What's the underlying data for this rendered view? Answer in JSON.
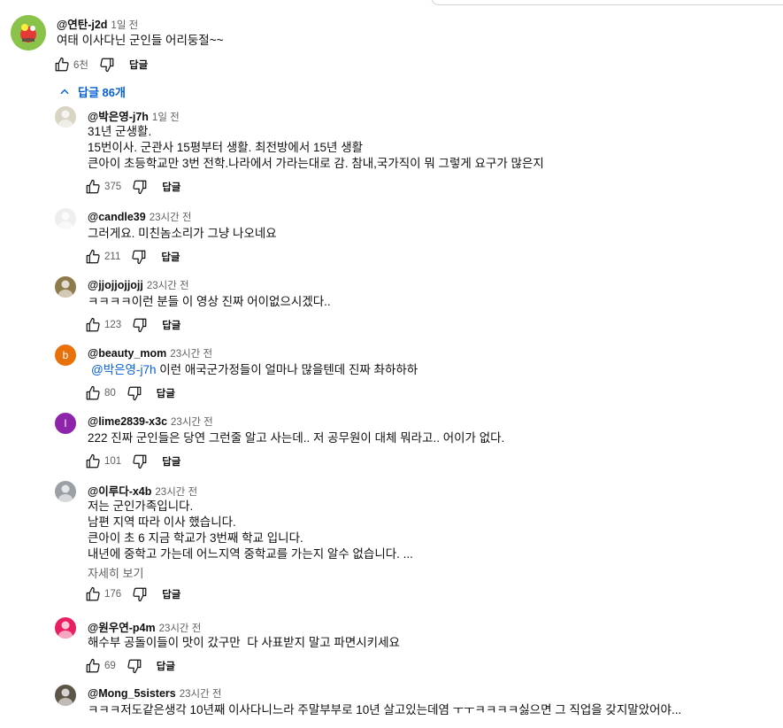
{
  "top_comment": {
    "author": "@연탄-j2d",
    "time": "1일 전",
    "text": "여태 이사다닌 군인들 어리둥절~~",
    "likes": "6천",
    "reply_label": "답글"
  },
  "replies_toggle": {
    "label": "답글 86개"
  },
  "replies": [
    {
      "author": "@박은영-j7h",
      "time": "1일 전",
      "lines": [
        "31년 군생활.",
        "15번이사. 군관사 15평부터 생활. 최전방에서 15년 생활",
        "큰아이 초등학교만 3번 전학.나라에서 가라는대로 감. 참내,국가직이 뭐 그렇게 요구가 많은지"
      ],
      "likes": "375",
      "reply_label": "답글",
      "avatar_color": "#d9d4c4"
    },
    {
      "author": "@candle39",
      "time": "23시간 전",
      "lines": [
        "그러게요. 미친놈소리가 그냥 나오네요"
      ],
      "likes": "211",
      "reply_label": "답글",
      "avatar_color": "#eeeeee"
    },
    {
      "author": "@jjojjojjojj",
      "time": "23시간 전",
      "lines": [
        "ㅋㅋㅋㅋ이런 분들 이 영상 진짜 어이없으시겠다.."
      ],
      "likes": "123",
      "reply_label": "답글",
      "avatar_color": "#8f7a4c"
    },
    {
      "author": "@beauty_mom",
      "time": "23시간 전",
      "mention": "@박은영-j7h",
      "lines": [
        " 이런 애국군가정들이 얼마나 많을텐데 진짜 촤하하하"
      ],
      "likes": "80",
      "reply_label": "답글",
      "avatar_letter": "b",
      "avatar_color": "#e8710a"
    },
    {
      "author": "@lime2839-x3c",
      "time": "23시간 전",
      "lines": [
        "222 진짜 군인들은 당연 그런줄 알고 사는데.. 저 공무원이 대체 뭐라고.. 어이가 없다."
      ],
      "likes": "101",
      "reply_label": "답글",
      "avatar_letter": "l",
      "avatar_color": "#8e24aa"
    },
    {
      "author": "@이루다-x4b",
      "time": "23시간 전",
      "lines": [
        "저는 군인가족입니다.",
        "남편 지역 따라 이사 했습니다.",
        "큰아이 초 6 지금 학교가 3번째 학교 입니다.",
        "내년에 중학고 가는데 어느지역 중학교를 가는지 알수 없습니다. ..."
      ],
      "more": "자세히 보기",
      "likes": "176",
      "reply_label": "답글",
      "avatar_color": "#9aa0a6"
    },
    {
      "author": "@원우연-p4m",
      "time": "23시간 전",
      "lines": [
        "해수부 공돌이들이 맛이 갔구만  다 사표받지 말고 파면시키세요"
      ],
      "likes": "69",
      "reply_label": "답글",
      "avatar_color": "#e91e63"
    },
    {
      "author": "@Mong_5sisters",
      "time": "23시간 전",
      "lines": [
        "ㅋㅋㅋ저도같은생각 10년째 이사다니느라 주말부부로 10년 살고있는데염 ㅜㅜㅋㅋㅋㅋ싫으면 그 직업을 갖지말았어야..."
      ],
      "avatar_color": "#5d5548"
    }
  ]
}
